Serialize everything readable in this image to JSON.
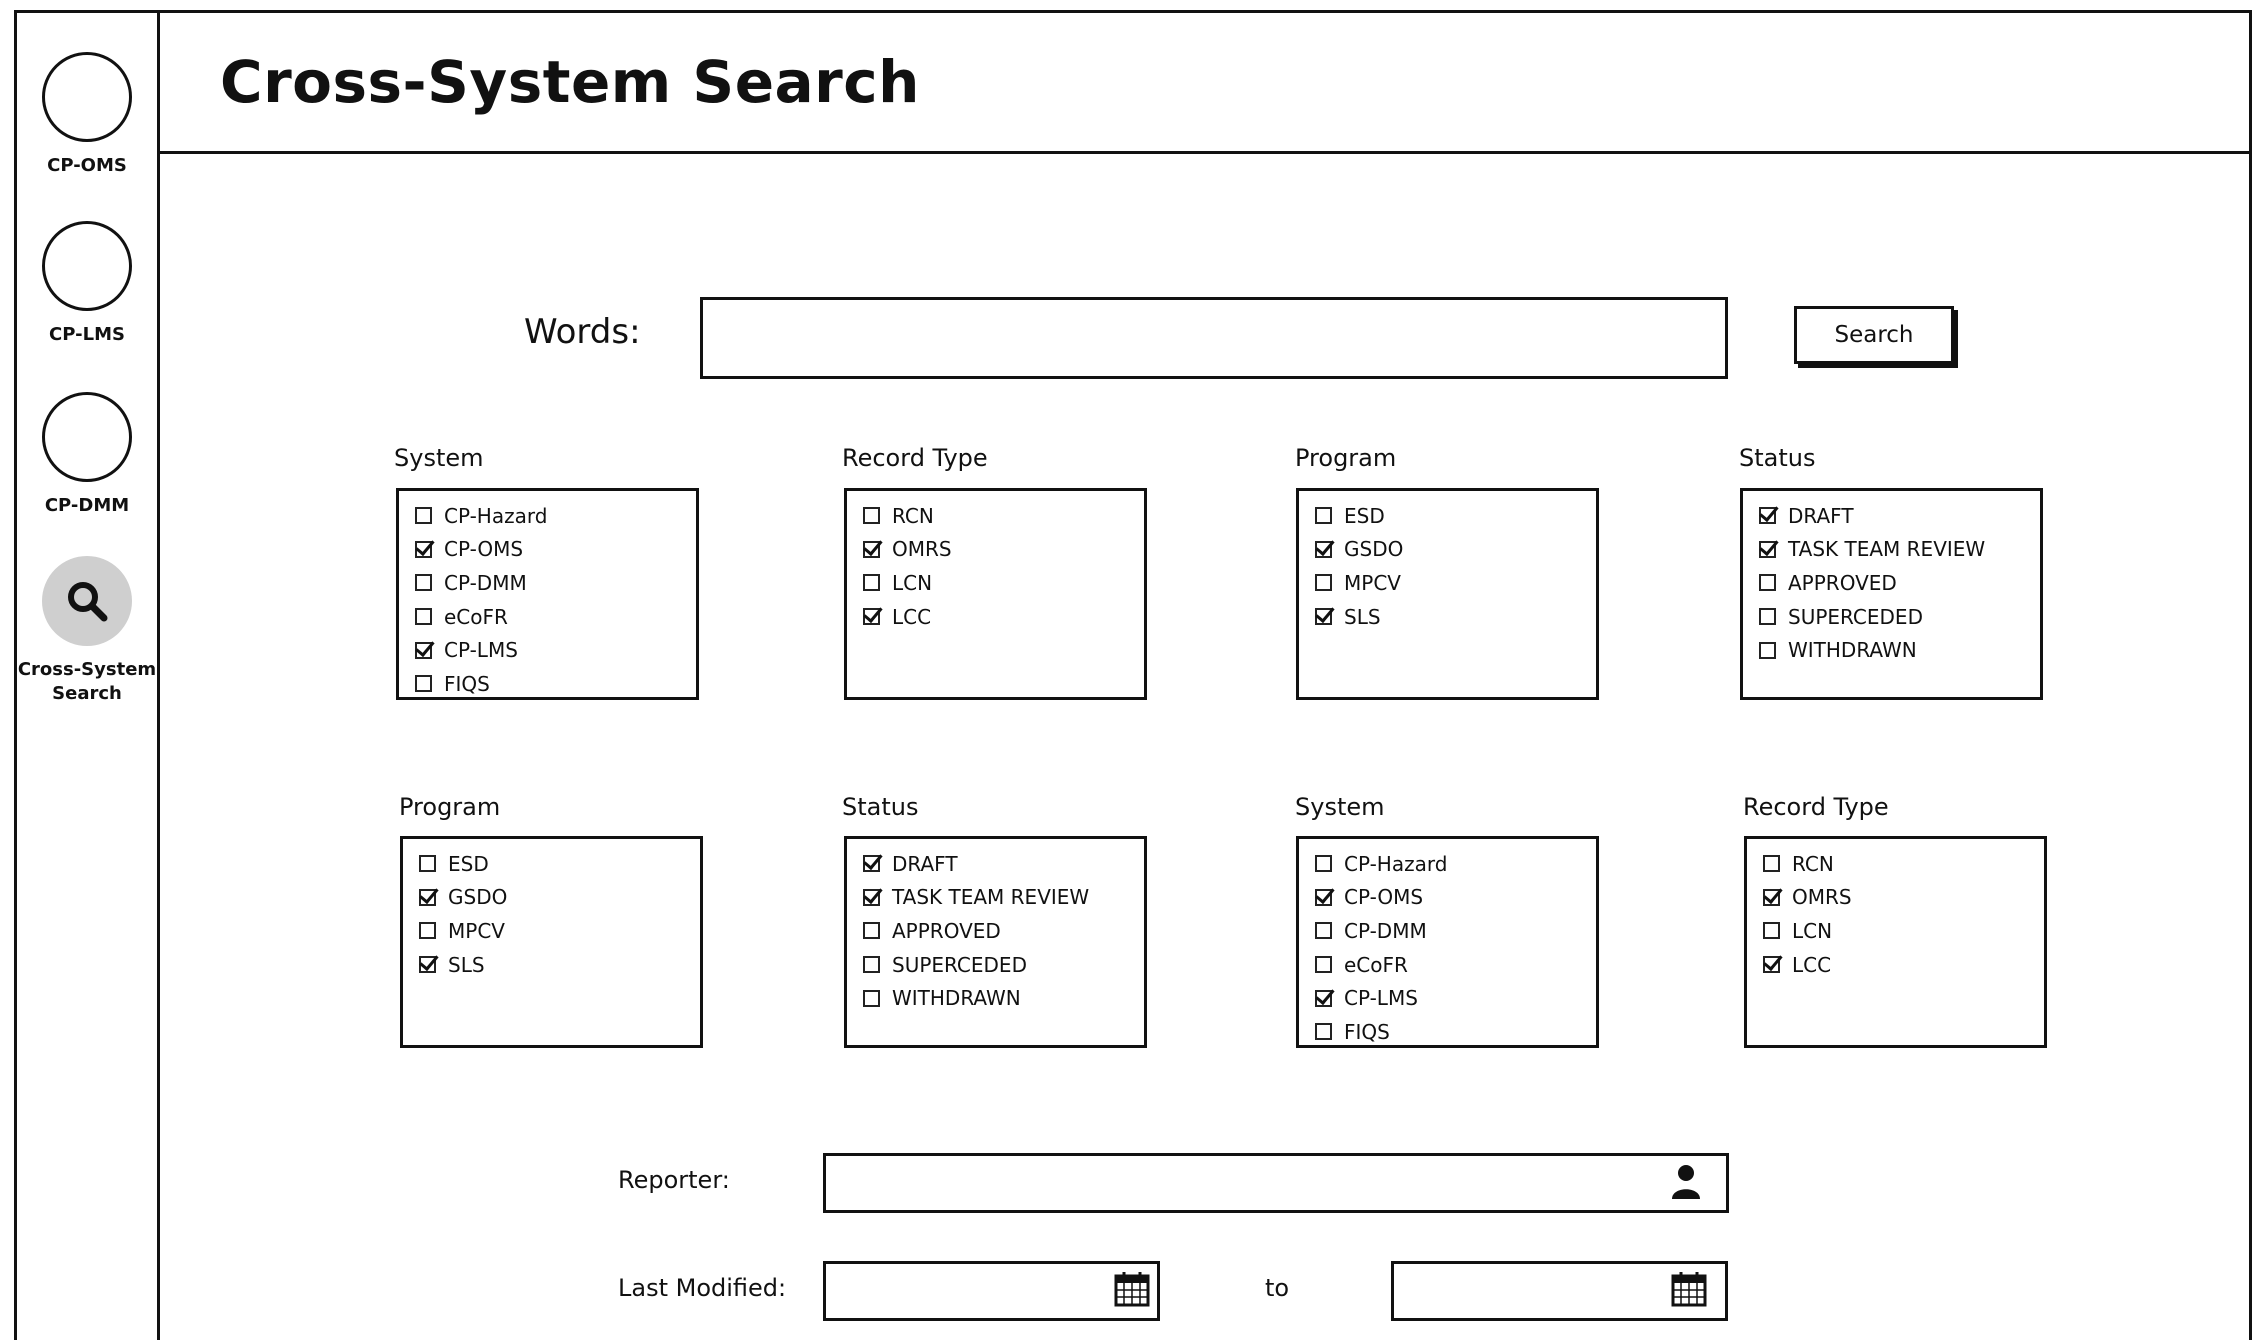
{
  "sidebar": {
    "items": [
      {
        "label": "CP-OMS",
        "icon": "circle-icon",
        "active": false
      },
      {
        "label": "CP-LMS",
        "icon": "circle-icon",
        "active": false
      },
      {
        "label": "CP-DMM",
        "icon": "circle-icon",
        "active": false
      },
      {
        "label": "Cross-System\nSearch",
        "icon": "search-icon",
        "active": true
      }
    ]
  },
  "header": {
    "title": "Cross-System Search"
  },
  "search": {
    "words_label": "Words:",
    "words_value": "",
    "button_label": "Search"
  },
  "filters": [
    {
      "title": "System",
      "options": [
        {
          "label": "CP-Hazard",
          "checked": false
        },
        {
          "label": "CP-OMS",
          "checked": true
        },
        {
          "label": "CP-DMM",
          "checked": false
        },
        {
          "label": "eCoFR",
          "checked": false
        },
        {
          "label": "CP-LMS",
          "checked": true
        },
        {
          "label": "FIQS",
          "checked": false
        }
      ]
    },
    {
      "title": "Record Type",
      "options": [
        {
          "label": "RCN",
          "checked": false
        },
        {
          "label": "OMRS",
          "checked": true
        },
        {
          "label": "LCN",
          "checked": false
        },
        {
          "label": "LCC",
          "checked": true
        }
      ]
    },
    {
      "title": "Program",
      "options": [
        {
          "label": "ESD",
          "checked": false
        },
        {
          "label": "GSDO",
          "checked": true
        },
        {
          "label": "MPCV",
          "checked": false
        },
        {
          "label": "SLS",
          "checked": true
        }
      ]
    },
    {
      "title": "Status",
      "options": [
        {
          "label": "DRAFT",
          "checked": true
        },
        {
          "label": "TASK TEAM REVIEW",
          "checked": true
        },
        {
          "label": "APPROVED",
          "checked": false
        },
        {
          "label": "SUPERCEDED",
          "checked": false
        },
        {
          "label": "WITHDRAWN",
          "checked": false
        }
      ]
    },
    {
      "title": "Program",
      "options": [
        {
          "label": "ESD",
          "checked": false
        },
        {
          "label": "GSDO",
          "checked": true
        },
        {
          "label": "MPCV",
          "checked": false
        },
        {
          "label": "SLS",
          "checked": true
        }
      ]
    },
    {
      "title": "Status",
      "options": [
        {
          "label": "DRAFT",
          "checked": true
        },
        {
          "label": "TASK TEAM REVIEW",
          "checked": true
        },
        {
          "label": "APPROVED",
          "checked": false
        },
        {
          "label": "SUPERCEDED",
          "checked": false
        },
        {
          "label": "WITHDRAWN",
          "checked": false
        }
      ]
    },
    {
      "title": "System",
      "options": [
        {
          "label": "CP-Hazard",
          "checked": false
        },
        {
          "label": "CP-OMS",
          "checked": true
        },
        {
          "label": "CP-DMM",
          "checked": false
        },
        {
          "label": "eCoFR",
          "checked": false
        },
        {
          "label": "CP-LMS",
          "checked": true
        },
        {
          "label": "FIQS",
          "checked": false
        }
      ]
    },
    {
      "title": "Record Type",
      "options": [
        {
          "label": "RCN",
          "checked": false
        },
        {
          "label": "OMRS",
          "checked": true
        },
        {
          "label": "LCN",
          "checked": false
        },
        {
          "label": "LCC",
          "checked": true
        }
      ]
    }
  ],
  "reporter": {
    "label": "Reporter:",
    "value": "",
    "icon": "user-icon"
  },
  "last_modified": {
    "label": "Last Modified:",
    "from_value": "",
    "to_label": "to",
    "to_value": "",
    "icon": "calendar-icon"
  }
}
